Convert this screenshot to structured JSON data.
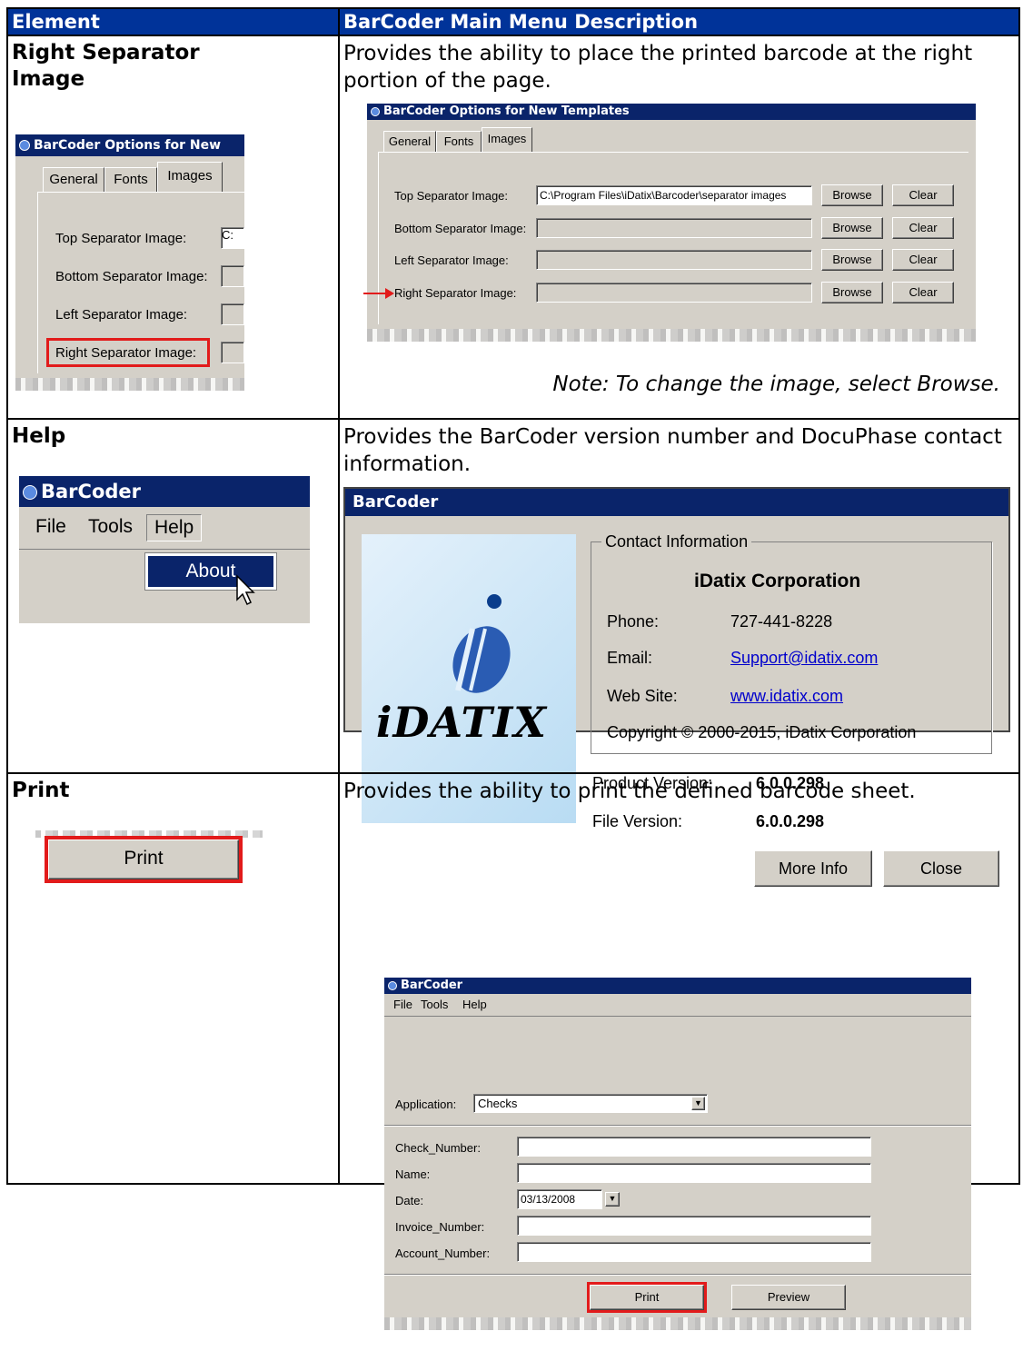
{
  "header": {
    "col1": "Element",
    "col2": "BarCoder Main Menu Description"
  },
  "rows": [
    {
      "element": "Right Separator Image",
      "description": "Provides the ability to place the printed barcode at the right portion of the page.",
      "note": "Note: To change the image, select Browse.",
      "thumb": {
        "title": "BarCoder Options for New",
        "tabs": [
          "General",
          "Fonts",
          "Images"
        ],
        "labels": [
          "Top Separator Image:",
          "Bottom Separator Image:",
          "Left Separator Image:",
          "Right Separator Image:"
        ],
        "field_value": "C:"
      },
      "dialog": {
        "title": "BarCoder Options for New Templates",
        "tabs": [
          "General",
          "Fonts",
          "Images"
        ],
        "labels": [
          "Top Separator Image:",
          "Bottom Separator Image:",
          "Left Separator Image:",
          "Right Separator Image:"
        ],
        "top_value": "C:\\Program Files\\iDatix\\Barcoder\\separator images",
        "browse": "Browse",
        "clear": "Clear"
      }
    },
    {
      "element": "Help",
      "description": "Provides the BarCoder version number and DocuPhase contact information.",
      "thumb": {
        "title": "BarCoder",
        "menu": [
          "File",
          "Tools",
          "Help"
        ],
        "menu_item": "About"
      },
      "dialog": {
        "title": "BarCoder",
        "logo_text": "iDATIX",
        "group_label": "Contact Information",
        "company": "iDatix Corporation",
        "phone_label": "Phone:",
        "phone": "727-441-8228",
        "email_label": "Email:",
        "email": "Support@idatix.com",
        "web_label": "Web Site:",
        "web": "www.idatix.com",
        "copyright": "Copyright © 2000-2015, iDatix Corporation",
        "product_version_label": "Product Version:",
        "product_version": "6.0.0.298",
        "file_version_label": "File Version:",
        "file_version": "6.0.0.298",
        "more_info": "More Info",
        "close": "Close"
      }
    },
    {
      "element": "Print",
      "description": "Provides the ability to print the defined barcode sheet.",
      "thumb": {
        "button": "Print"
      },
      "dialog": {
        "title": "BarCoder",
        "menu": [
          "File",
          "Tools",
          "Help"
        ],
        "application_label": "Application:",
        "application_value": "Checks",
        "fields": [
          "Check_Number:",
          "Name:",
          "Date:",
          "Invoice_Number:",
          "Account_Number:"
        ],
        "date_value": "03/13/2008",
        "print": "Print",
        "preview": "Preview"
      }
    }
  ]
}
